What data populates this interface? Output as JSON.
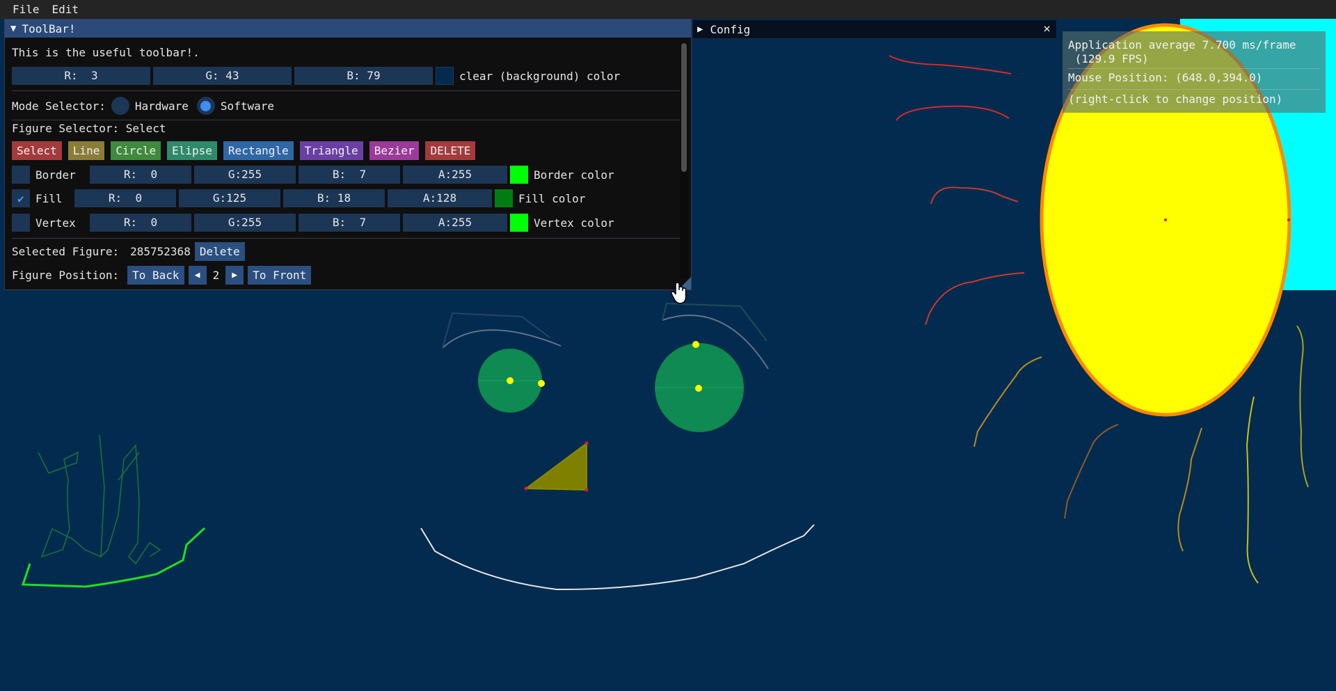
{
  "menu": {
    "file": "File",
    "edit": "Edit"
  },
  "toolbar": {
    "title": "ToolBar!",
    "intro": "This is the useful toolbar!.",
    "bg_r": "R:  3",
    "bg_g": "G: 43",
    "bg_b": "B: 79",
    "bg_color_label": "clear (background) color",
    "bg_color": "#032b4f",
    "mode_label": "Mode Selector:",
    "mode_options": [
      "Hardware",
      "Software"
    ],
    "mode_selected": "Software",
    "figure_selector_label": "Figure Selector: Select",
    "figure_buttons": [
      {
        "label": "Select",
        "color": "#a33a3c"
      },
      {
        "label": "Line",
        "color": "#8a7d38"
      },
      {
        "label": "Circle",
        "color": "#3f8a3c"
      },
      {
        "label": "Elipse",
        "color": "#2e8a6a"
      },
      {
        "label": "Rectangle",
        "color": "#2f67a6"
      },
      {
        "label": "Triangle",
        "color": "#6a3fa4"
      },
      {
        "label": "Bezier",
        "color": "#9c3a9a"
      },
      {
        "label": "DELETE",
        "color": "#a53a3c"
      }
    ],
    "border": {
      "label": "Border",
      "checked": false,
      "r": "R:  0",
      "g": "G:255",
      "b": "B:  7",
      "a": "A:255",
      "color_label": "Border color",
      "color": "#00ff07"
    },
    "fill": {
      "label": "Fill",
      "checked": true,
      "check_mark": "✔",
      "r": "R:  0",
      "g": "G:125",
      "b": "B: 18",
      "a": "A:128",
      "color_label": "Fill color",
      "color": "#007d12"
    },
    "vertex": {
      "label": "Vertex",
      "checked": false,
      "r": "R:  0",
      "g": "G:255",
      "b": "B:  7",
      "a": "A:255",
      "color_label": "Vertex color",
      "color": "#00ff07"
    },
    "selected_figure_label": "Selected Figure:",
    "selected_figure_id": "285752368",
    "delete_label": "Delete",
    "position_label": "Figure Position:",
    "to_back_label": "To Back",
    "position_value": "2",
    "to_front_label": "To Front"
  },
  "config": {
    "title": "Config",
    "close_icon": "×"
  },
  "overlay": {
    "line1": "Application average 7.700 ms/frame",
    "line2": " (129.9 FPS)",
    "mouse": "Mouse Position: (648.0,394.0)",
    "hint": "(right-click to change position)"
  },
  "colors": {
    "canvas_bg": "#032b4f",
    "sun_fill": "#ffff00",
    "sun_border": "#ff8a00",
    "cyan_rect": "#00ffff",
    "eye_fill": "#0e8a52",
    "nose_fill": "#808000",
    "vertex": "#ffff00",
    "smile": "#e6e6e6"
  }
}
